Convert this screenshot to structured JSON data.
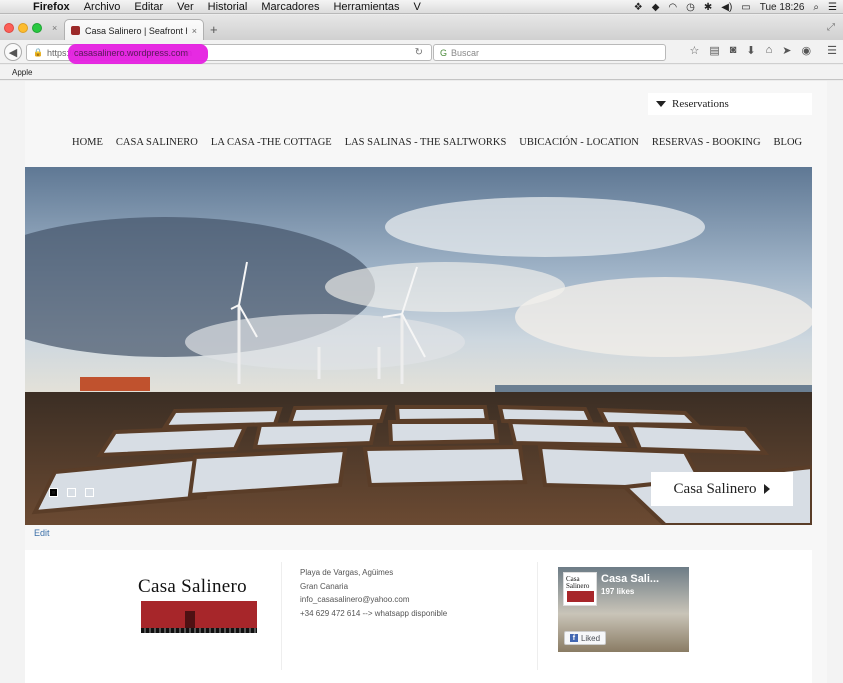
{
  "menubar": {
    "items": [
      "Firefox",
      "Archivo",
      "Editar",
      "Ver",
      "Historial",
      "Marcadores",
      "Herramientas",
      "V"
    ],
    "clock": "Tue 18:26"
  },
  "tab": {
    "title": "Casa Salinero | Seafront h...",
    "close": "×",
    "new_tab": "+"
  },
  "navbar": {
    "back": "◀",
    "url_scheme": "https://",
    "url_domain": "casasalinero.wordpress.com",
    "reload": "↻",
    "search_placeholder": "Buscar"
  },
  "bookmarks": {
    "apple": "Apple"
  },
  "page": {
    "reservations": "Reservations",
    "menu": [
      "HOME",
      "CASA SALINERO",
      "LA CASA -THE COTTAGE",
      "LAS SALINAS - THE SALTWORKS",
      "UBICACIÓN - LOCATION",
      "RESERVAS - BOOKING",
      "BLOG"
    ],
    "slider": {
      "caption": "Casa Salinero",
      "slide_count": 3,
      "active_slide": 1
    },
    "edit_link": "Edit",
    "footer": {
      "logo_text": "Casa Salinero",
      "address_lines": [
        "Playa de Vargas, Agüimes",
        "Gran Canaria",
        "info_casasalinero@yahoo.com",
        "+34 629 472 614 --> whatsapp disponible"
      ],
      "facebook": {
        "name": "Casa Sali...",
        "likes": "197 likes",
        "button": "Liked",
        "logo_text": "Casa Salinero"
      }
    }
  },
  "colors": {
    "highlight": "#e51fe0",
    "brand_red": "#a7262a",
    "link": "#3b6fa8"
  }
}
